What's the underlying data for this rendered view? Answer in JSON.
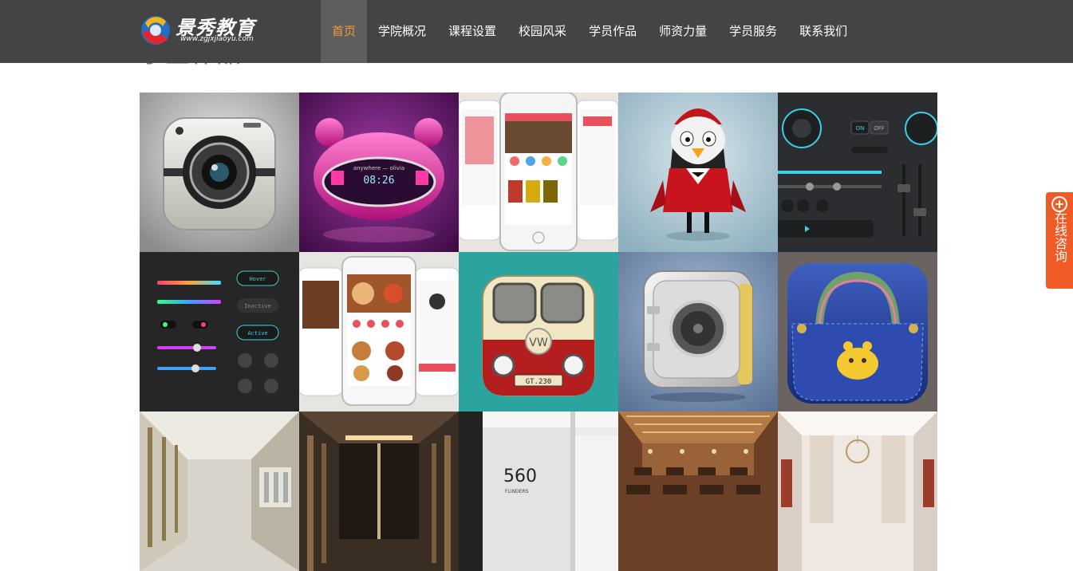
{
  "header": {
    "logo": {
      "title": "景秀教育",
      "url": "www.zgjxjiaoyu.com"
    },
    "nav": [
      {
        "label": "首页",
        "active": true
      },
      {
        "label": "学院概况",
        "active": false
      },
      {
        "label": "课程设置",
        "active": false
      },
      {
        "label": "校园风采",
        "active": false
      },
      {
        "label": "学员作品",
        "active": false
      },
      {
        "label": "师资力量",
        "active": false
      },
      {
        "label": "学员服务",
        "active": false
      },
      {
        "label": "联系我们",
        "active": false
      }
    ]
  },
  "section": {
    "title": "学生作品"
  },
  "gallery": {
    "rows": [
      [
        "camera-icon-artwork",
        "music-player-artwork",
        "bookstore-app-artwork",
        "penguin-character-artwork",
        "audio-controls-artwork"
      ],
      [
        "ui-kit-sliders-artwork",
        "food-app-artwork",
        "vw-bus-icon-artwork",
        "safe-icon-artwork",
        "pocket-lock-icon-artwork"
      ],
      [
        "corridor-interior-artwork",
        "lobby-interior-artwork",
        "shop-560-interior-artwork",
        "restaurant-interior-artwork",
        "banquet-hall-interior-artwork"
      ]
    ],
    "texts": {
      "player_time": "08:26",
      "player_song": "anywhere — olivia",
      "bus_plate": "GT.230",
      "shop_sign": "560",
      "shop_sub": "FLINDERS",
      "btn_hover": "Hover",
      "btn_inactive": "Inactive",
      "btn_active": "Active",
      "toggle_on": "ON",
      "toggle_off": "OFF"
    }
  },
  "consult": {
    "label": "在线咨询"
  },
  "colors": {
    "header_bg": "#444444",
    "nav_active": "#f29d38",
    "consult_bg": "#f05a24"
  }
}
